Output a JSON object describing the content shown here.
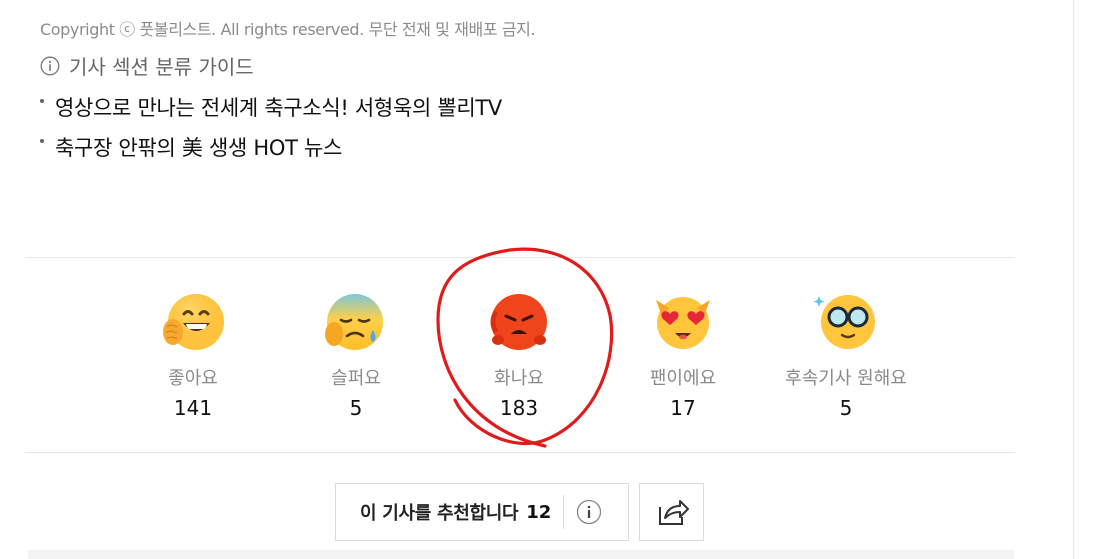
{
  "article_footer": {
    "copyright": "Copyright ⓒ 풋볼리스트. All rights reserved. 무단 전재 및 재배포 금지.",
    "section_guide": "기사 섹션 분류 가이드",
    "related_links": [
      "영상으로 만나는 전세계 축구소식! 서형욱의 뽈리TV",
      "축구장 안팎의 美 생생 HOT 뉴스"
    ]
  },
  "reactions": [
    {
      "label": "좋아요",
      "count": "141",
      "icon": "laughing-face-icon"
    },
    {
      "label": "슬퍼요",
      "count": "5",
      "icon": "crying-face-icon"
    },
    {
      "label": "화나요",
      "count": "183",
      "icon": "angry-face-icon"
    },
    {
      "label": "팬이에요",
      "count": "17",
      "icon": "heart-eyes-face-icon"
    },
    {
      "label": "후속기사 원해요",
      "count": "5",
      "icon": "glasses-face-icon"
    }
  ],
  "recommend": {
    "label": "이 기사를 추천합니다",
    "count": "12",
    "info_icon": "info-icon"
  },
  "share": {
    "icon": "share-icon"
  },
  "annotation": {
    "color": "#e01b1b",
    "target": "화나요"
  }
}
